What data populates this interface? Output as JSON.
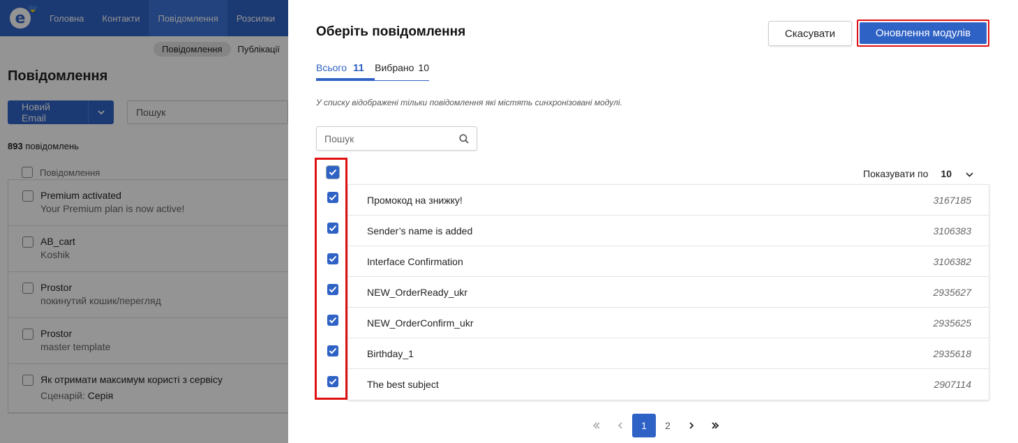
{
  "background": {
    "nav": [
      "Головна",
      "Контакти",
      "Повідомлення",
      "Розсилки"
    ],
    "active_nav_index": 2,
    "subnav": [
      "Повідомлення",
      "Публікації"
    ],
    "title": "Повідомлення",
    "new_email": "Новий Email",
    "search_placeholder": "Пошук",
    "count_number": "893",
    "count_label": "повідомлень",
    "list_header": "Повідомлення",
    "items": [
      {
        "title": "Premium activated",
        "subtitle": "Your Premium plan is now active!"
      },
      {
        "title": "AB_cart",
        "subtitle": "Koshik"
      },
      {
        "title": "Prostor",
        "subtitle": "покинутий кошик/перегляд"
      },
      {
        "title": "Prostor",
        "subtitle": "master template"
      },
      {
        "title": "Як отримати максимум користі з сервісу",
        "scenario_label": "Сценарій:",
        "scenario_value": "Серія"
      }
    ]
  },
  "modal": {
    "title": "Оберіть повідомлення",
    "cancel": "Скасувати",
    "update": "Оновлення модулів",
    "tab_all_label": "Всього",
    "tab_all_count": "11",
    "tab_selected_label": "Вибрано",
    "tab_selected_count": "10",
    "note": "У списку відображені тільки повідомлення які містять синхронізовані модулі.",
    "search_placeholder": "Пошук",
    "per_page_label": "Показувати по",
    "per_page_value": "10",
    "rows": [
      {
        "name": "Промокод на знижку!",
        "id": "3167185",
        "checked": true
      },
      {
        "name": "Sender’s name is added",
        "id": "3106383",
        "checked": true
      },
      {
        "name": "Interface Confirmation",
        "id": "3106382",
        "checked": true
      },
      {
        "name": "NEW_OrderReady_ukr",
        "id": "2935627",
        "checked": true
      },
      {
        "name": "NEW_OrderConfirm_ukr",
        "id": "2935625",
        "checked": true
      },
      {
        "name": "Birthday_1",
        "id": "2935618",
        "checked": true
      },
      {
        "name": "The best subject",
        "id": "2907114",
        "checked": true
      }
    ],
    "pagination": {
      "pages": [
        "1",
        "2"
      ],
      "current": "1"
    }
  },
  "colors": {
    "primary": "#2f62c5",
    "highlight": "#e01010"
  }
}
